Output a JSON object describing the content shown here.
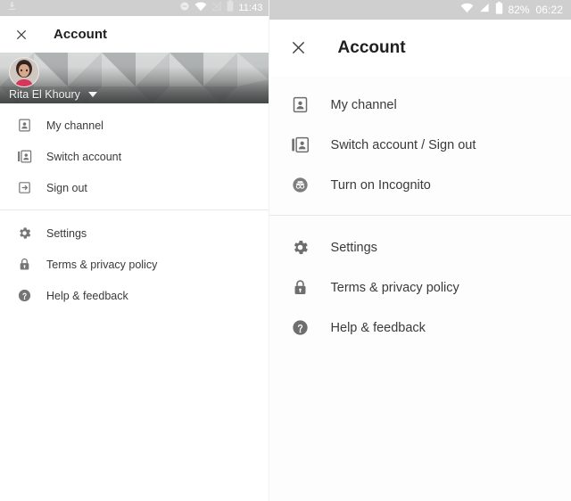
{
  "left_screen": {
    "status_bar": {
      "left_icons": [
        "download-icon"
      ],
      "right_icons": [
        "do-not-disturb-icon",
        "wifi-icon",
        "signal-off-icon",
        "battery-icon"
      ],
      "time": "11:43"
    },
    "app_bar": {
      "close_icon": "close-icon",
      "title": "Account"
    },
    "profile": {
      "name": "Rita El Khoury",
      "caret_icon": "chevron-down-icon",
      "avatar_icon": "avatar"
    },
    "menu_group_1": [
      {
        "label": "My channel",
        "icon": "person-box-icon"
      },
      {
        "label": "Switch account",
        "icon": "switch-account-icon"
      },
      {
        "label": "Sign out",
        "icon": "sign-out-icon"
      }
    ],
    "menu_group_2": [
      {
        "label": "Settings",
        "icon": "gear-icon"
      },
      {
        "label": "Terms & privacy policy",
        "icon": "lock-icon"
      },
      {
        "label": "Help & feedback",
        "icon": "help-circle-icon"
      }
    ]
  },
  "right_screen": {
    "status_bar": {
      "right_icons": [
        "wifi-icon",
        "signal-icon",
        "battery-icon"
      ],
      "battery_percent": "82%",
      "time": "06:22"
    },
    "app_bar": {
      "close_icon": "close-icon",
      "title": "Account"
    },
    "menu_group_1": [
      {
        "label": "My channel",
        "icon": "person-box-icon"
      },
      {
        "label": "Switch account / Sign out",
        "icon": "switch-account-icon"
      },
      {
        "label": "Turn on Incognito",
        "icon": "incognito-icon"
      }
    ],
    "menu_group_2": [
      {
        "label": "Settings",
        "icon": "gear-icon"
      },
      {
        "label": "Terms & privacy policy",
        "icon": "lock-icon"
      },
      {
        "label": "Help & feedback",
        "icon": "help-circle-icon"
      }
    ]
  },
  "colors": {
    "status_bar_bg": "#cfcfcf",
    "icon_gray": "#757575",
    "text_primary": "#3a3a3a",
    "title": "#202020",
    "divider": "#e8e8e8"
  }
}
